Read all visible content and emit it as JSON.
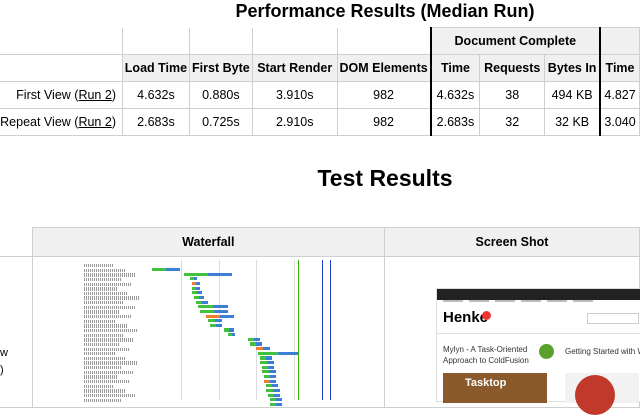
{
  "performance": {
    "title": "Performance Results (Median Run)",
    "group_header": "Document Complete",
    "columns": [
      "Load Time",
      "First Byte",
      "Start Render",
      "DOM Elements",
      "Time",
      "Requests",
      "Bytes In",
      "Time"
    ],
    "rows": [
      {
        "label": "First View",
        "run_link": "Run 2",
        "cells": [
          "4.632s",
          "0.880s",
          "3.910s",
          "982",
          "4.632s",
          "38",
          "494 KB",
          "4.827"
        ]
      },
      {
        "label": "Repeat View",
        "run_link": "Run 2",
        "cells": [
          "2.683s",
          "0.725s",
          "2.910s",
          "982",
          "2.683s",
          "32",
          "32 KB",
          "3.040"
        ]
      }
    ]
  },
  "results": {
    "title": "Test Results",
    "columns": [
      "Waterfall",
      "Screen Shot"
    ],
    "side_text": [
      "w",
      ")"
    ]
  },
  "screenshot": {
    "logo": "Henke",
    "headline_left": "Mylyn - A Task-Oriented Approach to ColdFusion",
    "headline_right": "Getting Started with Wh",
    "image_caption": "Tasktop"
  }
}
